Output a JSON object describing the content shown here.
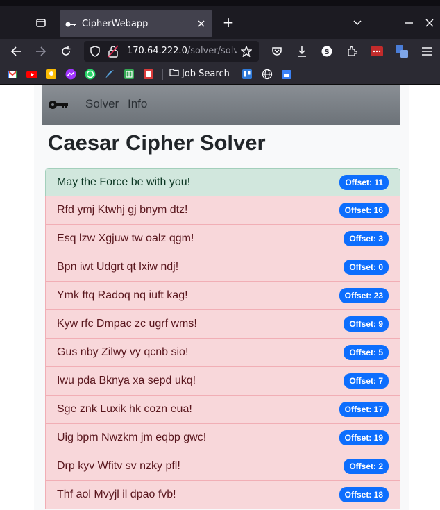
{
  "browser": {
    "tab_title": "CipherWebapp",
    "url_host": "170.64.222.0",
    "url_path": "/solver/solve",
    "bookmark_folder": "Job Search"
  },
  "site": {
    "nav_links": [
      "Solver",
      "Info"
    ],
    "page_title": "Caesar Cipher Solver"
  },
  "results": [
    {
      "text": "May the Force be with you!",
      "offset": "Offset: 11",
      "status": "success"
    },
    {
      "text": "Rfd ymj Ktwhj gj bnym dtz!",
      "offset": "Offset: 16",
      "status": "fail"
    },
    {
      "text": "Esq lzw Xgjuw tw oalz qgm!",
      "offset": "Offset: 3",
      "status": "fail"
    },
    {
      "text": "Bpn iwt Udgrt qt lxiw ndj!",
      "offset": "Offset: 0",
      "status": "fail"
    },
    {
      "text": "Ymk ftq Radoq nq iuft kag!",
      "offset": "Offset: 23",
      "status": "fail"
    },
    {
      "text": "Kyw rfc Dmpac zc ugrf wms!",
      "offset": "Offset: 9",
      "status": "fail"
    },
    {
      "text": "Gus nby Zilwy vy qcnb sio!",
      "offset": "Offset: 5",
      "status": "fail"
    },
    {
      "text": "Iwu pda Bknya xa sepd ukq!",
      "offset": "Offset: 7",
      "status": "fail"
    },
    {
      "text": "Sge znk Luxik hk cozn eua!",
      "offset": "Offset: 17",
      "status": "fail"
    },
    {
      "text": "Uig bpm Nwzkm jm eqbp gwc!",
      "offset": "Offset: 19",
      "status": "fail"
    },
    {
      "text": "Drp kyv Wfitv sv nzky pfl!",
      "offset": "Offset: 2",
      "status": "fail"
    },
    {
      "text": "Thf aol Mvyjl il dpao fvb!",
      "offset": "Offset: 18",
      "status": "fail"
    }
  ],
  "colors": {
    "success_bg": "#d1e7dd",
    "fail_bg": "#f8d7da",
    "badge": "#0d6efd"
  }
}
